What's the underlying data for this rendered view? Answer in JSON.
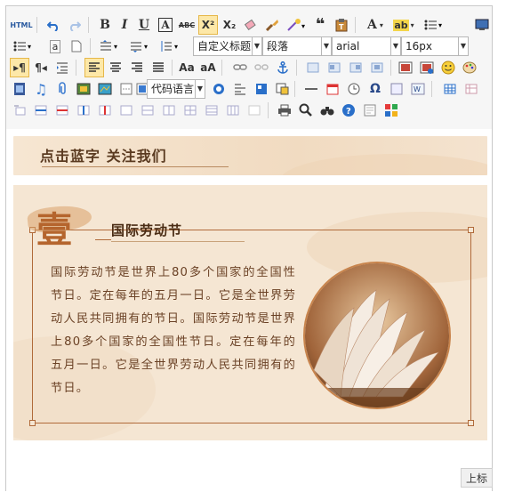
{
  "toolbar": {
    "row1": {
      "html_label": "HTML",
      "bold_label": "B",
      "italic_label": "I",
      "underline_label": "U",
      "font_border_label": "A",
      "strike_label": "ABC",
      "superscript_label": "X²",
      "subscript_label": "X₂",
      "font_color_label": "A",
      "bg_color_label": "ab"
    },
    "row2": {
      "custom_title": "自定义标题",
      "paragraph": "段落",
      "font_family": "arial",
      "font_size": "16px"
    },
    "row4": {
      "code_language": "代码语言"
    }
  },
  "content": {
    "card1": {
      "title": "点击蓝字 关注我们"
    },
    "card2": {
      "badge_char": "壹",
      "title": "国际劳动节",
      "body": "国际劳动节是世界上80多个国家的全国性节日。定在每年的五月一日。它是全世界劳动人民共同拥有的节日。国际劳动节是世界上80多个国家的全国性节日。定在每年的五月一日。它是全世界劳动人民共同拥有的节日。"
    }
  },
  "footer": {
    "tag": "上标"
  }
}
